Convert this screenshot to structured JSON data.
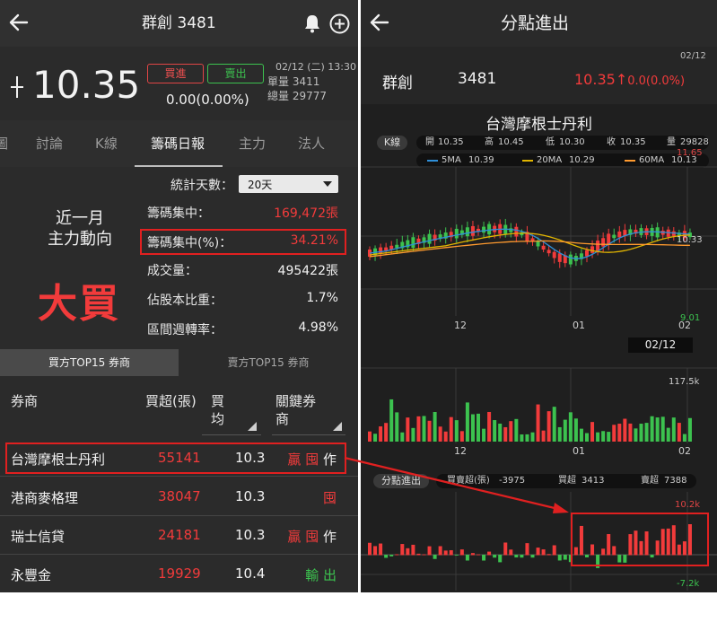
{
  "left": {
    "header": {
      "title": "群創 3481"
    },
    "quote": {
      "price": "10.35",
      "change": "0.00(0.00%)",
      "buy_label": "買進",
      "sell_label": "賣出",
      "datetime": "02/12 (二) 13:30",
      "unit_volume_label": "單量",
      "unit_volume": "3411",
      "total_volume_label": "總量",
      "total_volume": "29777"
    },
    "tabs": [
      "圖",
      "討論",
      "K線",
      "籌碼日報",
      "主力",
      "法人"
    ],
    "active_tab": "籌碼日報",
    "stats": {
      "days_label": "統計天數：",
      "days_value": "20天",
      "summary_line1": "近一月",
      "summary_line2": "主力動向",
      "verdict": "大買",
      "rows": [
        {
          "label": "籌碼集中：",
          "value": "169,472張"
        },
        {
          "label": "籌碼集中(%)：",
          "value": "34.21%"
        },
        {
          "label": "成交量：",
          "value": "495422張"
        },
        {
          "label": "佔股本比重：",
          "value": "1.7%"
        },
        {
          "label": "區間週轉率：",
          "value": "4.98%"
        }
      ]
    },
    "subtabs": [
      "買方TOP15 券商",
      "賣方TOP15 券商"
    ],
    "table": {
      "headers": {
        "broker": "券商",
        "net": "買超(張)",
        "avg1": "買",
        "avg2": "均",
        "key1": "關鍵券",
        "key2": "商"
      },
      "rows": [
        {
          "broker": "台灣摩根士丹利",
          "net": "55141",
          "avg": "10.3",
          "tag_red": "贏 囤",
          "tag_white": "作"
        },
        {
          "broker": "港商麥格理",
          "net": "38047",
          "avg": "10.3",
          "tag_red": "囤",
          "tag_white": ""
        },
        {
          "broker": "瑞士信貸",
          "net": "24181",
          "avg": "10.3",
          "tag_red": "贏 囤",
          "tag_white": "作"
        },
        {
          "broker": "永豐金",
          "net": "19929",
          "avg": "10.4",
          "tag_green": "輸 出"
        }
      ]
    }
  },
  "right": {
    "header": {
      "title": "分點進出"
    },
    "quote": {
      "date": "02/12",
      "name": "群創",
      "code": "3481",
      "price": "10.35",
      "change": "0.0(0.0%)"
    },
    "chart_title": "台灣摩根士丹利",
    "kline_label": "K線",
    "ohlc": {
      "open_label": "開",
      "open": "10.35",
      "high_label": "高",
      "high": "10.45",
      "low_label": "低",
      "low": "10.30",
      "close_label": "收",
      "close": "10.35",
      "vol_label": "量",
      "vol": "29828"
    },
    "ma": {
      "ma5_label": "5MA",
      "ma5": "10.39",
      "ma20_label": "20MA",
      "ma20": "10.29",
      "ma60_label": "60MA",
      "ma60": "10.13"
    },
    "axis": {
      "price_top": "11.65",
      "price_mid": "10.33",
      "price_low": "9.01",
      "x_ticks": [
        "12",
        "01",
        "02"
      ],
      "date_box": "02/12",
      "vol_top": "117.5k",
      "net_top": "10.2k",
      "net_bottom": "-7.2k"
    },
    "branch": {
      "label": "分點進出",
      "net_label": "買賣超(張)",
      "net": "-3975",
      "buy_label": "買超",
      "buy": "3413",
      "sell_label": "賣超",
      "sell": "7388"
    },
    "colors": {
      "up": "#f23b3b",
      "down": "#3cc24f",
      "ma5": "#2f8fd8",
      "ma20": "#e0b400",
      "ma60": "#ff9a2e"
    }
  }
}
